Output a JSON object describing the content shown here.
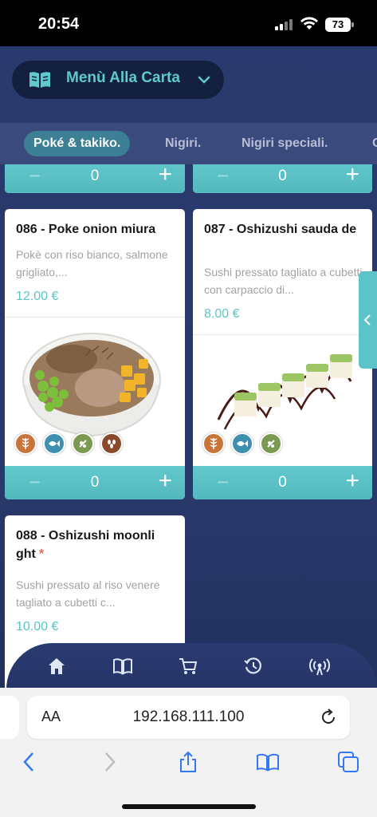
{
  "status_bar": {
    "time": "20:54",
    "battery": "73"
  },
  "menu_selector": {
    "label": "Menù Alla Carta"
  },
  "tabs": [
    {
      "label": "Poké & takiko.",
      "active": true
    },
    {
      "label": "Nigiri.",
      "active": false
    },
    {
      "label": "Nigiri speciali.",
      "active": false
    },
    {
      "label": "C",
      "active": false
    }
  ],
  "top_steppers": {
    "left_qty": "0",
    "right_qty": "0",
    "minus": "−",
    "plus": "+"
  },
  "products": [
    {
      "title": "086 - Poke onion miura",
      "description": "Pokè con riso bianco, salmone grigliato,...",
      "price": "12.00 €",
      "quantity": "0",
      "allergens": [
        "wheat-icon",
        "fish-icon",
        "soy-icon",
        "sesame-icon"
      ]
    },
    {
      "title": "087 - Oshizushi sauda de",
      "description": "Sushi pressato tagliato a cubetti con carpaccio di...",
      "price": "8.00 €",
      "quantity": "0",
      "allergens": [
        "wheat-icon",
        "fish-icon",
        "soy-icon"
      ]
    },
    {
      "title": "088 - Oshizushi moonli ght",
      "marker": "*",
      "description": "Sushi pressato al riso venere tagliato a cubetti c...",
      "price": "10.00 €"
    }
  ],
  "bottom_nav": [
    "home-icon",
    "menu-book-icon",
    "cart-icon",
    "history-icon",
    "broadcast-icon"
  ],
  "safari": {
    "aa_label": "AA",
    "url": "192.168.111.100"
  },
  "colors": {
    "accent": "#5cc4c9",
    "background": "#2a3a6e",
    "status_bar": "#000000"
  }
}
